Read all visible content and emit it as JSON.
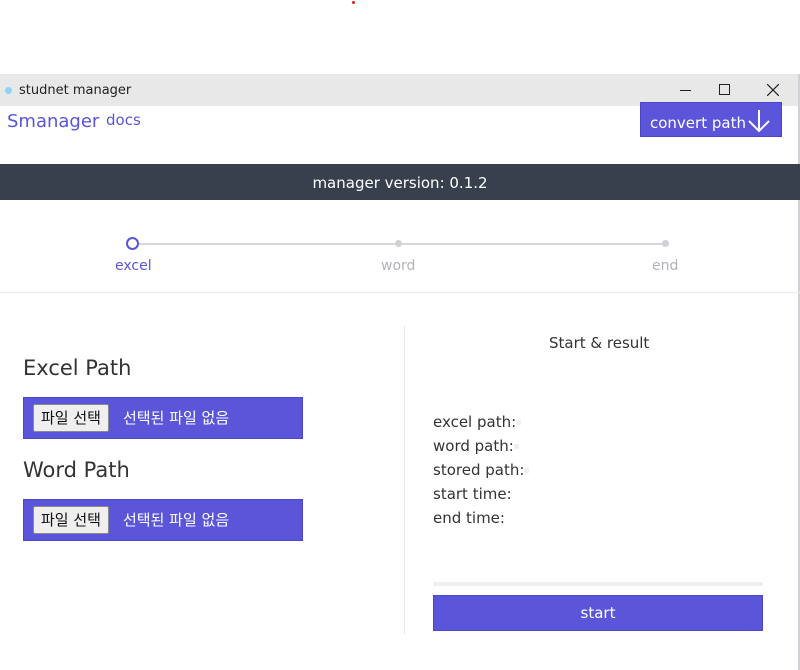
{
  "window": {
    "title": "studnet manager"
  },
  "nav": {
    "brand": "Smanager",
    "docs": "docs",
    "convert_label": "convert path"
  },
  "version_bar": {
    "text": "manager version: 0.1.2"
  },
  "steps": [
    {
      "label": "excel",
      "active": true
    },
    {
      "label": "word",
      "active": false
    },
    {
      "label": "end",
      "active": false
    }
  ],
  "excel": {
    "title": "Excel Path",
    "button": "파일 선택",
    "status": "선택된 파일 없음"
  },
  "word": {
    "title": "Word Path",
    "button": "파일 선택",
    "status": "선택된 파일 없음"
  },
  "result": {
    "title": "Start & result",
    "excel_path": "excel path:",
    "word_path": "word path:",
    "stored_path": "stored path:",
    "start_time": "start time:",
    "end_time": "end time:",
    "progress": 0
  },
  "start_button": "start",
  "colors": {
    "accent": "#5a55d9",
    "version_bar": "#38404e",
    "titlebar": "#e8e8e8"
  }
}
